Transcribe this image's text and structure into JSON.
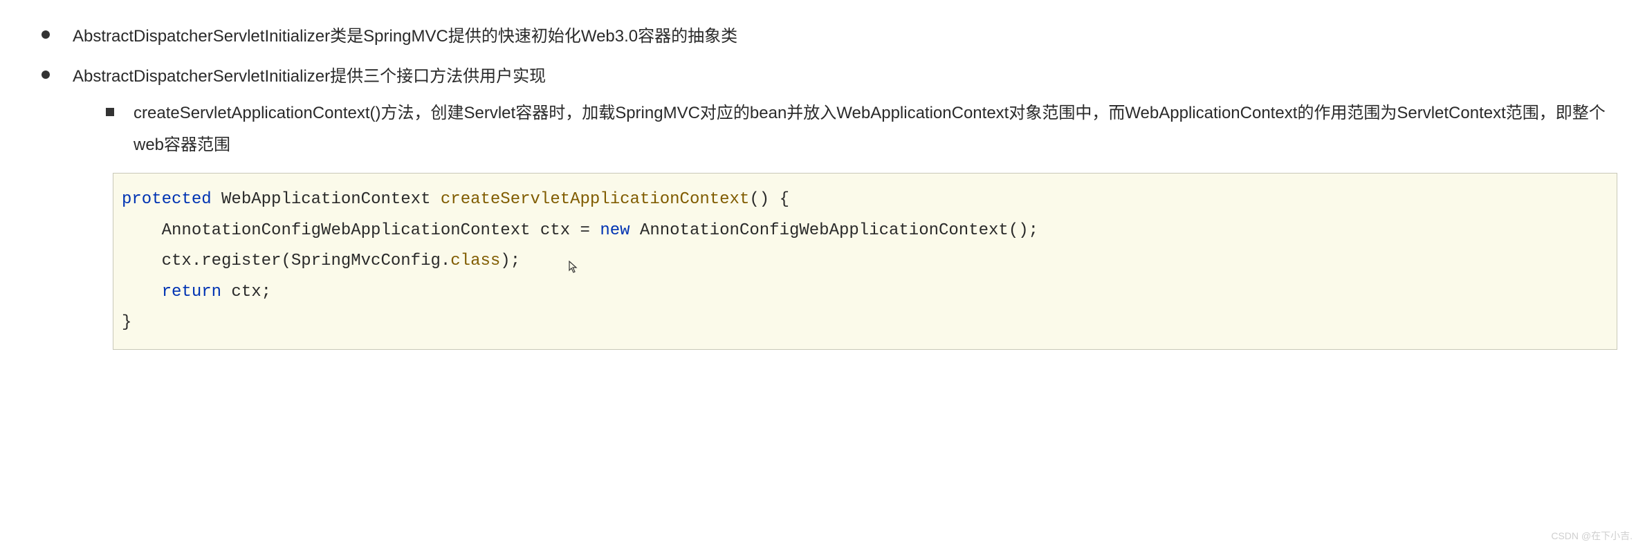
{
  "bullets": {
    "item1": "AbstractDispatcherServletInitializer类是SpringMVC提供的快速初始化Web3.0容器的抽象类",
    "item2": "AbstractDispatcherServletInitializer提供三个接口方法供用户实现",
    "sub1": "createServletApplicationContext()方法，创建Servlet容器时，加载SpringMVC对应的bean并放入WebApplicationContext对象范围中，而WebApplicationContext的作用范围为ServletContext范围，即整个web容器范围"
  },
  "code": {
    "line1_kw1": "protected",
    "line1_type": " WebApplicationContext ",
    "line1_method": "createServletApplicationContext",
    "line1_rest": "() {",
    "line2_pre": "    AnnotationConfigWebApplicationContext ctx = ",
    "line2_new": "new",
    "line2_post": " AnnotationConfigWebApplicationContext();",
    "line3_pre": "    ctx.register(SpringMvcConfig.",
    "line3_class": "class",
    "line3_post": ");",
    "line4_pre": "    ",
    "line4_return": "return",
    "line4_post": " ctx;",
    "line5": "}"
  },
  "watermark": "CSDN @在下小吉."
}
